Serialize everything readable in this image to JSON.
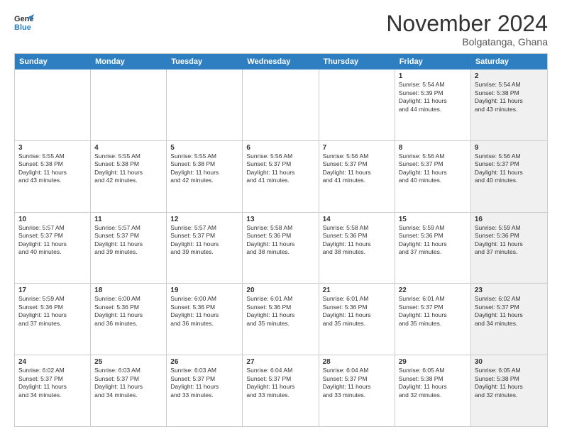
{
  "logo": {
    "general": "General",
    "blue": "Blue"
  },
  "header": {
    "month": "November 2024",
    "location": "Bolgatanga, Ghana"
  },
  "weekdays": [
    "Sunday",
    "Monday",
    "Tuesday",
    "Wednesday",
    "Thursday",
    "Friday",
    "Saturday"
  ],
  "rows": [
    [
      {
        "day": "",
        "info": "",
        "shaded": false,
        "empty": true
      },
      {
        "day": "",
        "info": "",
        "shaded": false,
        "empty": true
      },
      {
        "day": "",
        "info": "",
        "shaded": false,
        "empty": true
      },
      {
        "day": "",
        "info": "",
        "shaded": false,
        "empty": true
      },
      {
        "day": "",
        "info": "",
        "shaded": false,
        "empty": true
      },
      {
        "day": "1",
        "info": "Sunrise: 5:54 AM\nSunset: 5:39 PM\nDaylight: 11 hours\nand 44 minutes.",
        "shaded": false,
        "empty": false
      },
      {
        "day": "2",
        "info": "Sunrise: 5:54 AM\nSunset: 5:38 PM\nDaylight: 11 hours\nand 43 minutes.",
        "shaded": true,
        "empty": false
      }
    ],
    [
      {
        "day": "3",
        "info": "Sunrise: 5:55 AM\nSunset: 5:38 PM\nDaylight: 11 hours\nand 43 minutes.",
        "shaded": false,
        "empty": false
      },
      {
        "day": "4",
        "info": "Sunrise: 5:55 AM\nSunset: 5:38 PM\nDaylight: 11 hours\nand 42 minutes.",
        "shaded": false,
        "empty": false
      },
      {
        "day": "5",
        "info": "Sunrise: 5:55 AM\nSunset: 5:38 PM\nDaylight: 11 hours\nand 42 minutes.",
        "shaded": false,
        "empty": false
      },
      {
        "day": "6",
        "info": "Sunrise: 5:56 AM\nSunset: 5:37 PM\nDaylight: 11 hours\nand 41 minutes.",
        "shaded": false,
        "empty": false
      },
      {
        "day": "7",
        "info": "Sunrise: 5:56 AM\nSunset: 5:37 PM\nDaylight: 11 hours\nand 41 minutes.",
        "shaded": false,
        "empty": false
      },
      {
        "day": "8",
        "info": "Sunrise: 5:56 AM\nSunset: 5:37 PM\nDaylight: 11 hours\nand 40 minutes.",
        "shaded": false,
        "empty": false
      },
      {
        "day": "9",
        "info": "Sunrise: 5:56 AM\nSunset: 5:37 PM\nDaylight: 11 hours\nand 40 minutes.",
        "shaded": true,
        "empty": false
      }
    ],
    [
      {
        "day": "10",
        "info": "Sunrise: 5:57 AM\nSunset: 5:37 PM\nDaylight: 11 hours\nand 40 minutes.",
        "shaded": false,
        "empty": false
      },
      {
        "day": "11",
        "info": "Sunrise: 5:57 AM\nSunset: 5:37 PM\nDaylight: 11 hours\nand 39 minutes.",
        "shaded": false,
        "empty": false
      },
      {
        "day": "12",
        "info": "Sunrise: 5:57 AM\nSunset: 5:37 PM\nDaylight: 11 hours\nand 39 minutes.",
        "shaded": false,
        "empty": false
      },
      {
        "day": "13",
        "info": "Sunrise: 5:58 AM\nSunset: 5:36 PM\nDaylight: 11 hours\nand 38 minutes.",
        "shaded": false,
        "empty": false
      },
      {
        "day": "14",
        "info": "Sunrise: 5:58 AM\nSunset: 5:36 PM\nDaylight: 11 hours\nand 38 minutes.",
        "shaded": false,
        "empty": false
      },
      {
        "day": "15",
        "info": "Sunrise: 5:59 AM\nSunset: 5:36 PM\nDaylight: 11 hours\nand 37 minutes.",
        "shaded": false,
        "empty": false
      },
      {
        "day": "16",
        "info": "Sunrise: 5:59 AM\nSunset: 5:36 PM\nDaylight: 11 hours\nand 37 minutes.",
        "shaded": true,
        "empty": false
      }
    ],
    [
      {
        "day": "17",
        "info": "Sunrise: 5:59 AM\nSunset: 5:36 PM\nDaylight: 11 hours\nand 37 minutes.",
        "shaded": false,
        "empty": false
      },
      {
        "day": "18",
        "info": "Sunrise: 6:00 AM\nSunset: 5:36 PM\nDaylight: 11 hours\nand 36 minutes.",
        "shaded": false,
        "empty": false
      },
      {
        "day": "19",
        "info": "Sunrise: 6:00 AM\nSunset: 5:36 PM\nDaylight: 11 hours\nand 36 minutes.",
        "shaded": false,
        "empty": false
      },
      {
        "day": "20",
        "info": "Sunrise: 6:01 AM\nSunset: 5:36 PM\nDaylight: 11 hours\nand 35 minutes.",
        "shaded": false,
        "empty": false
      },
      {
        "day": "21",
        "info": "Sunrise: 6:01 AM\nSunset: 5:36 PM\nDaylight: 11 hours\nand 35 minutes.",
        "shaded": false,
        "empty": false
      },
      {
        "day": "22",
        "info": "Sunrise: 6:01 AM\nSunset: 5:37 PM\nDaylight: 11 hours\nand 35 minutes.",
        "shaded": false,
        "empty": false
      },
      {
        "day": "23",
        "info": "Sunrise: 6:02 AM\nSunset: 5:37 PM\nDaylight: 11 hours\nand 34 minutes.",
        "shaded": true,
        "empty": false
      }
    ],
    [
      {
        "day": "24",
        "info": "Sunrise: 6:02 AM\nSunset: 5:37 PM\nDaylight: 11 hours\nand 34 minutes.",
        "shaded": false,
        "empty": false
      },
      {
        "day": "25",
        "info": "Sunrise: 6:03 AM\nSunset: 5:37 PM\nDaylight: 11 hours\nand 34 minutes.",
        "shaded": false,
        "empty": false
      },
      {
        "day": "26",
        "info": "Sunrise: 6:03 AM\nSunset: 5:37 PM\nDaylight: 11 hours\nand 33 minutes.",
        "shaded": false,
        "empty": false
      },
      {
        "day": "27",
        "info": "Sunrise: 6:04 AM\nSunset: 5:37 PM\nDaylight: 11 hours\nand 33 minutes.",
        "shaded": false,
        "empty": false
      },
      {
        "day": "28",
        "info": "Sunrise: 6:04 AM\nSunset: 5:37 PM\nDaylight: 11 hours\nand 33 minutes.",
        "shaded": false,
        "empty": false
      },
      {
        "day": "29",
        "info": "Sunrise: 6:05 AM\nSunset: 5:38 PM\nDaylight: 11 hours\nand 32 minutes.",
        "shaded": false,
        "empty": false
      },
      {
        "day": "30",
        "info": "Sunrise: 6:05 AM\nSunset: 5:38 PM\nDaylight: 11 hours\nand 32 minutes.",
        "shaded": true,
        "empty": false
      }
    ]
  ]
}
